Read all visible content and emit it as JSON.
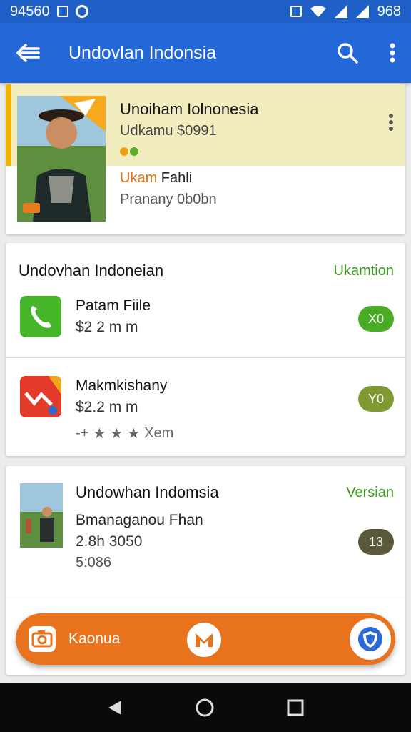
{
  "status_bar": {
    "time": "94560",
    "right_text": "968",
    "icons": [
      "box-icon",
      "alarm-icon",
      "sim-icon",
      "wifi-icon",
      "signal-icon",
      "battery-icon"
    ]
  },
  "app_bar": {
    "title": "Undovlan Indonsia",
    "icons": [
      "back-arrow-icon",
      "search-icon",
      "more-vert-icon"
    ]
  },
  "profile": {
    "name": "Unoiham Iolnonesia",
    "subtitle": "Udkamu $0991",
    "label_orange": "Ukam",
    "label_rest": " Fahli",
    "line2": "Pranany 0b0bn"
  },
  "section1": {
    "header": "Undovhan Indoneian",
    "link": "Ukamtion",
    "items": [
      {
        "title": "Patam Fiile",
        "price": "$2 2 m m",
        "badge": "X0",
        "badge_color": "#4aac24"
      },
      {
        "title": "Makmkishany",
        "price": "$2.2 m m",
        "badge": "Y0",
        "badge_color": "#7f9a32",
        "rating_text": "Xem"
      }
    ]
  },
  "section2": {
    "header": "Undowhan Indomsia",
    "link": "Versian",
    "title": "Bmanaganou Fhan",
    "line1": "2.8h 3050",
    "line2": "5:086",
    "badge": "13",
    "badge_color": "#5a5a3a"
  },
  "fab_bar": {
    "label": "Kaonua",
    "icons": [
      "camera-icon",
      "m-logo-icon",
      "shield-icon"
    ]
  },
  "nav_bar": {
    "icons": [
      "back-triangle-icon",
      "home-circle-icon",
      "recents-square-icon"
    ]
  },
  "colors": {
    "primary": "#2467d6",
    "accent_orange": "#e8731c",
    "accent_green": "#3c9b1f",
    "highlight": "#f1edbf"
  }
}
